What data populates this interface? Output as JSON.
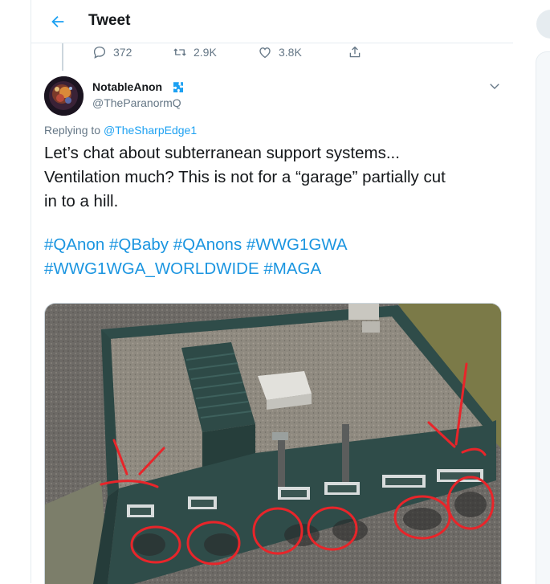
{
  "header": {
    "title": "Tweet",
    "back_icon": "arrow-left-icon"
  },
  "parent_actions": {
    "reply_count": "372",
    "retweet_count": "2.9K",
    "like_count": "3.8K",
    "icons": [
      "reply-icon",
      "retweet-icon",
      "like-icon",
      "share-icon"
    ]
  },
  "tweet": {
    "author_name": "NotableAnon",
    "author_handle": "@TheParanormQ",
    "replying_to_prefix": "Replying to",
    "replying_to_handle": "@TheSharpEdge1",
    "text_lines": [
      "Let’s chat about subterranean support systems...",
      "Ventilation much? This is not for a “garage” partially cut",
      "in to a hill."
    ],
    "hashtags_line1": [
      "#QAnon",
      "#QBaby",
      "#QAnons",
      "#WWG1GWA"
    ],
    "hashtags_line2": [
      "#WWG1WGA_WORLDWIDE",
      "#MAGA"
    ]
  },
  "colors": {
    "accent": "#1da1f2",
    "hashtag": "#1b95e0",
    "text": "#14171a",
    "secondary": "#657786",
    "annotation_red": "#e8252a",
    "wall_green": "#2f4c49"
  }
}
